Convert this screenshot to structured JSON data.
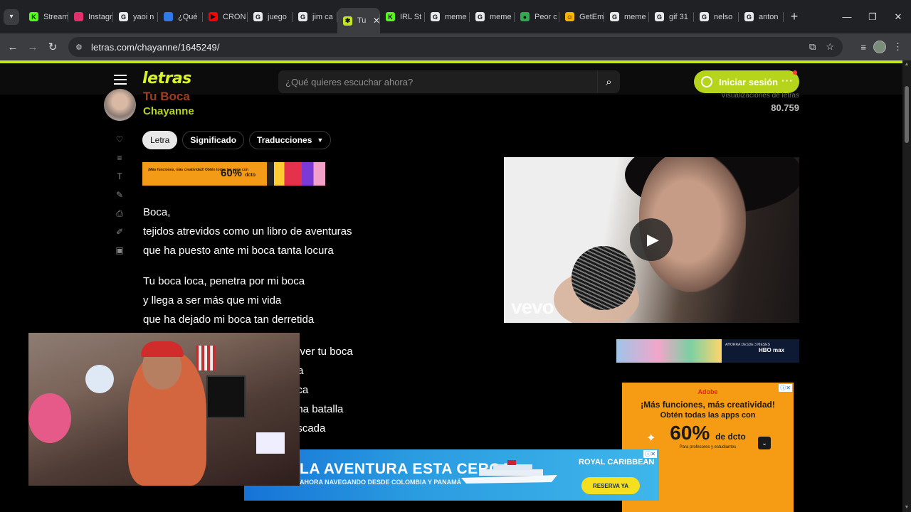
{
  "browser": {
    "tabs": [
      {
        "title": "Stream",
        "color": "#53fc18",
        "glyph": "K"
      },
      {
        "title": "Instagram",
        "color": "#e1306c",
        "glyph": ""
      },
      {
        "title": "yaoi n",
        "color": "#e8eaed",
        "glyph": "G"
      },
      {
        "title": "¿Qué",
        "color": "#2f7ae5",
        "glyph": ""
      },
      {
        "title": "CRON",
        "color": "#ff0000",
        "glyph": "▶"
      },
      {
        "title": "juego",
        "color": "#e8eaed",
        "glyph": "G"
      },
      {
        "title": "jim ca",
        "color": "#e8eaed",
        "glyph": "G"
      },
      {
        "title": "Tu",
        "color": "#c4e51f",
        "glyph": "✱",
        "active": true
      },
      {
        "title": "IRL St",
        "color": "#53fc18",
        "glyph": "K"
      },
      {
        "title": "meme",
        "color": "#e8eaed",
        "glyph": "G"
      },
      {
        "title": "meme",
        "color": "#e8eaed",
        "glyph": "G"
      },
      {
        "title": "Peor c",
        "color": "#34a853",
        "glyph": "●"
      },
      {
        "title": "GetEm",
        "color": "#f5b400",
        "glyph": "☺"
      },
      {
        "title": "meme",
        "color": "#e8eaed",
        "glyph": "G"
      },
      {
        "title": "gif 31",
        "color": "#e8eaed",
        "glyph": "G"
      },
      {
        "title": "nelso",
        "color": "#e8eaed",
        "glyph": "G"
      },
      {
        "title": "anton",
        "color": "#e8eaed",
        "glyph": "G"
      }
    ],
    "url": "letras.com/chayanne/1645249/"
  },
  "site": {
    "logo": "letras",
    "search_placeholder": "¿Qué quieres escuchar ahora?",
    "login_label": "Iniciar sesión"
  },
  "song": {
    "title": "Tu Boca",
    "artist": "Chayanne",
    "views_label": "Visualizaciones de letras",
    "views": "80.759",
    "tabs": [
      "Letra",
      "Significado",
      "Traducciones"
    ]
  },
  "lyrics": [
    [
      "Boca,",
      "tejidos atrevidos como un libro de aventuras",
      "que ha puesto ante mi boca tanta locura"
    ],
    [
      "Tu boca loca, penetra por mi boca",
      "y llega a ser más que mi vida",
      "que ha dejado mi boca tan derretida"
    ],
    [
      "n ver tu boca",
      "tra",
      "oca",
      "una batalla",
      "oscada"
    ]
  ],
  "video": {
    "watermark": "vevo"
  },
  "ads": {
    "small_banner_text": "¡Más funciones, más creatividad! Obtén todas las apps con",
    "small_banner_pct": "60%",
    "small_banner_suffix": "dcto",
    "hbo": "HBO max",
    "hbo_text": "AHORRA DESDE 3 MESES",
    "adobe_brand": "Adobe",
    "adobe_h1": "¡Más funciones, más creatividad!",
    "adobe_h2": "Obtén todas las apps con",
    "adobe_pct": "60%",
    "adobe_pct_suffix": "de dcto",
    "adobe_foot": "Para profesores y estudiantes",
    "cruise_title": "LA AVENTURA ESTA CERCA",
    "cruise_sub": "AHORA NAVEGANDO DESDE COLOMBIA Y PANAMÁ",
    "cruise_brand": "ROYAL CARIBBEAN",
    "cruise_cta": "RESERVA YA"
  }
}
